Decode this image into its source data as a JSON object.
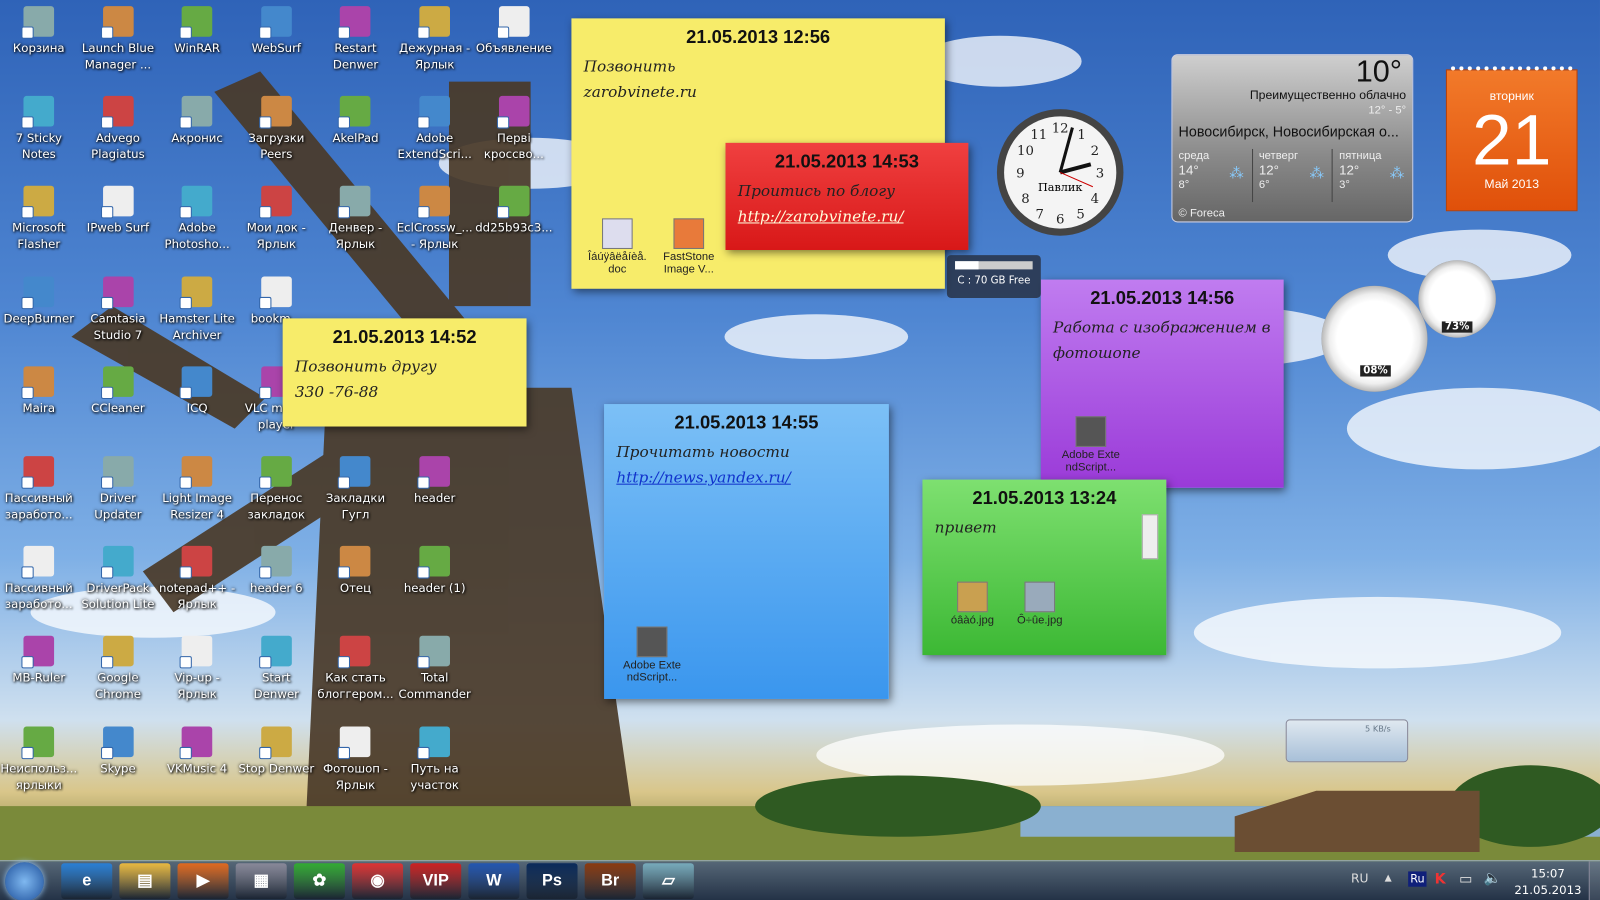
{
  "desktop_icons": [
    [
      "Корзина",
      "Launch Blue Manager ...",
      "WinRAR",
      "WebSurf",
      "Restart Denwer",
      "Дежурная - Ярлык",
      "Объявление"
    ],
    [
      "7 Sticky Notes",
      "Advego Plagiatus",
      "Акронис",
      "Загрузки Peers",
      "AkelPad",
      "Adobe ExtendScri...",
      "Перві кроссво..."
    ],
    [
      "Microsoft Flasher",
      "IPweb Surf",
      "Adobe Photosho...",
      "Мои док - Ярлык",
      "Денвер - Ярлык",
      "EclCrossw_... - Ярлык",
      "dd25b93c3..."
    ],
    [
      "DeepBurner",
      "Camtasia Studio 7",
      "Hamster Lite Archiver",
      "bookm...",
      "",
      "",
      ""
    ],
    [
      "Maira",
      "CCleaner",
      "ICQ",
      "VLC media player",
      "",
      "",
      ""
    ],
    [
      "Пассивный заработо...",
      "Driver Updater",
      "Light Image Resizer 4",
      "Перенос закладок",
      "Закладки Гугл",
      "header",
      ""
    ],
    [
      "Пассивный заработо...",
      "DriverPack Solution Lite",
      "notepad++ - Ярлык",
      "header 6",
      "Отец",
      "header (1)",
      ""
    ],
    [
      "MB-Ruler",
      "Google Chrome",
      "Vip-up - Ярлык",
      "Start Denwer",
      "Как стать блоггером...",
      "Total Commander",
      ""
    ],
    [
      "Неиспольз... ярлыки",
      "Skype",
      "VKMusic 4",
      "Stop Denwer",
      "Фотошоп - Ярлык",
      "Путь на участок",
      ""
    ]
  ],
  "notes": {
    "n1": {
      "timestamp": "21.05.2013 12:56",
      "lines": [
        "Позвонить",
        "zarobvinete.ru"
      ],
      "attachments": [
        "Îáúÿâëåíèå. doc",
        "FastStone Image V..."
      ],
      "color": "#f7ec6a"
    },
    "n2": {
      "timestamp": "21.05.2013 14:53",
      "text": "Проитись по блогу",
      "link": "http://zarobvinete.ru/",
      "color": "#e8262a"
    },
    "n3": {
      "timestamp": "21.05.2013 14:52",
      "lines": [
        "Позвонить другу",
        "330 -76-88"
      ],
      "color": "#f7ec6a"
    },
    "n4": {
      "timestamp": "21.05.2013 14:55",
      "text": "Прочитать новости",
      "link": "http://news.yandex.ru/",
      "attachments": [
        "Adobe Exte ndScript..."
      ],
      "color": "#4fa6f0"
    },
    "n5": {
      "timestamp": "21.05.2013 14:56",
      "text": "Работа с изображением в фотошопе",
      "attachments": [
        "Adobe Exte ndScript..."
      ],
      "color": "#a34de0"
    },
    "n6": {
      "timestamp": "21.05.2013 13:24",
      "text": "привет",
      "attachments": [
        "óâàó.jpg",
        "Ô÷ûe.jpg"
      ],
      "color": "#5ccf4a"
    }
  },
  "clock": {
    "label": "Павлик"
  },
  "drive": {
    "label": "C : 70 GB Free",
    "used_fraction": 0.3
  },
  "meters": {
    "cpu": "08%",
    "ram": "73%"
  },
  "network": {
    "speed": "5 KB/s"
  },
  "weather": {
    "temp": "10°",
    "condition": "Преимущественно облачно",
    "range": "12°  -  5°",
    "location": "Новосибирск, Новосибирская о...",
    "days": [
      {
        "name": "среда",
        "hi": "14°",
        "lo": "8°"
      },
      {
        "name": "четверг",
        "hi": "12°",
        "lo": "6°"
      },
      {
        "name": "пятница",
        "hi": "12°",
        "lo": "3°"
      }
    ],
    "credit": "© Foreca"
  },
  "calendar": {
    "weekday": "вторник",
    "day": "21",
    "month": "Май 2013",
    "color": "#e8560c"
  },
  "taskbar": {
    "apps": [
      "Internet Explorer",
      "Explorer",
      "Media Player",
      "Calculator",
      "ICQ",
      "Chrome",
      "VIP",
      "W",
      "Ps",
      "Br",
      "Sticky"
    ],
    "lang": "RU",
    "ime": "Ru",
    "time": "15:07",
    "date": "21.05.2013"
  }
}
